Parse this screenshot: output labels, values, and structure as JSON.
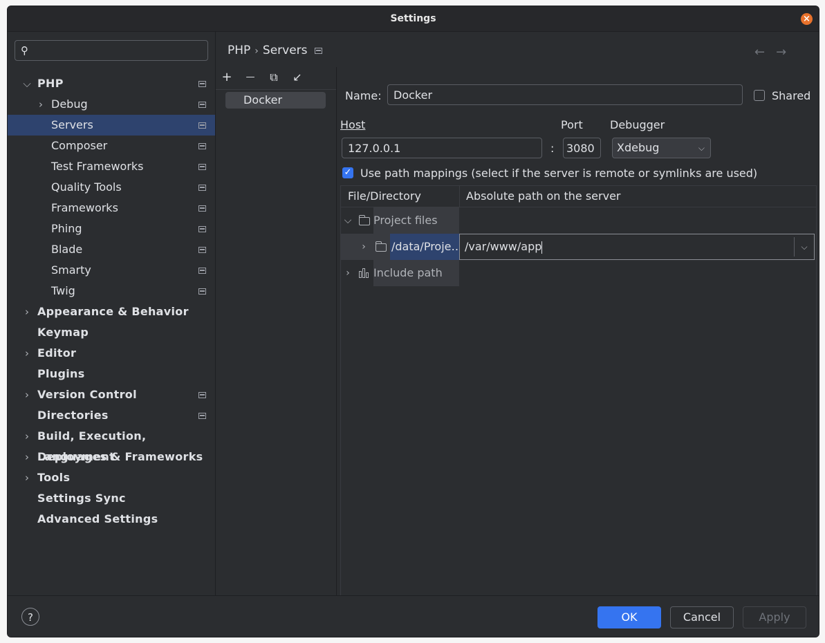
{
  "window": {
    "title": "Settings"
  },
  "sidebar": {
    "search_placeholder": "",
    "items": [
      {
        "label": "PHP",
        "level": 0,
        "arrow": "down",
        "proj": true
      },
      {
        "label": "Debug",
        "level": 1,
        "arrow": "right",
        "proj": true
      },
      {
        "label": "Servers",
        "level": 1,
        "arrow": "",
        "proj": true,
        "selected": true
      },
      {
        "label": "Composer",
        "level": 1,
        "arrow": "",
        "proj": true
      },
      {
        "label": "Test Frameworks",
        "level": 1,
        "arrow": "",
        "proj": true
      },
      {
        "label": "Quality Tools",
        "level": 1,
        "arrow": "",
        "proj": true
      },
      {
        "label": "Frameworks",
        "level": 1,
        "arrow": "",
        "proj": true
      },
      {
        "label": "Phing",
        "level": 1,
        "arrow": "",
        "proj": true
      },
      {
        "label": "Blade",
        "level": 1,
        "arrow": "",
        "proj": true
      },
      {
        "label": "Smarty",
        "level": 1,
        "arrow": "",
        "proj": true
      },
      {
        "label": "Twig",
        "level": 1,
        "arrow": "",
        "proj": true
      },
      {
        "label": "Appearance & Behavior",
        "level": 0,
        "arrow": "right",
        "proj": false
      },
      {
        "label": "Keymap",
        "level": 0,
        "arrow": "",
        "proj": false
      },
      {
        "label": "Editor",
        "level": 0,
        "arrow": "right",
        "proj": false
      },
      {
        "label": "Plugins",
        "level": 0,
        "arrow": "",
        "proj": false
      },
      {
        "label": "Version Control",
        "level": 0,
        "arrow": "right",
        "proj": true
      },
      {
        "label": "Directories",
        "level": 0,
        "arrow": "",
        "proj": true
      },
      {
        "label": "Build, Execution, Deployment",
        "level": 0,
        "arrow": "right",
        "proj": false
      },
      {
        "label": "Languages & Frameworks",
        "level": 0,
        "arrow": "right",
        "proj": false
      },
      {
        "label": "Tools",
        "level": 0,
        "arrow": "right",
        "proj": false
      },
      {
        "label": "Settings Sync",
        "level": 0,
        "arrow": "",
        "proj": false
      },
      {
        "label": "Advanced Settings",
        "level": 0,
        "arrow": "",
        "proj": false
      }
    ]
  },
  "breadcrumb": {
    "parent": "PHP",
    "separator": "›",
    "current": "Servers"
  },
  "nav": {
    "back": "←",
    "forward": "→"
  },
  "servers": {
    "toolbar": {
      "add": "+",
      "remove": "—",
      "copy": "⧉",
      "import": "↙"
    },
    "items": [
      "Docker"
    ]
  },
  "form": {
    "name_label": "Name:",
    "name_value": "Docker",
    "shared_label": "Shared",
    "shared_checked": false,
    "host_label": "Host",
    "host_value": "127.0.0.1",
    "colon": ":",
    "port_label": "Port",
    "port_value": "3080",
    "debugger_label": "Debugger",
    "debugger_value": "Xdebug",
    "mappings_label": "Use path mappings (select if the server is remote or symlinks are used)",
    "mappings_checked": true
  },
  "mappings": {
    "headers": [
      "File/Directory",
      "Absolute path on the server"
    ],
    "rows": [
      {
        "label": "Project files",
        "arrow": "down",
        "icon": "folder"
      },
      {
        "label": "/data/Proje…",
        "arrow": "right",
        "icon": "folder",
        "server_path": "/var/www/app"
      },
      {
        "label": "Include path",
        "arrow": "right",
        "icon": "library"
      }
    ]
  },
  "footer": {
    "help": "?",
    "ok": "OK",
    "cancel": "Cancel",
    "apply": "Apply"
  },
  "colors": {
    "accent": "#3574f0",
    "selection": "#2e436e",
    "background": "#2b2d30"
  }
}
